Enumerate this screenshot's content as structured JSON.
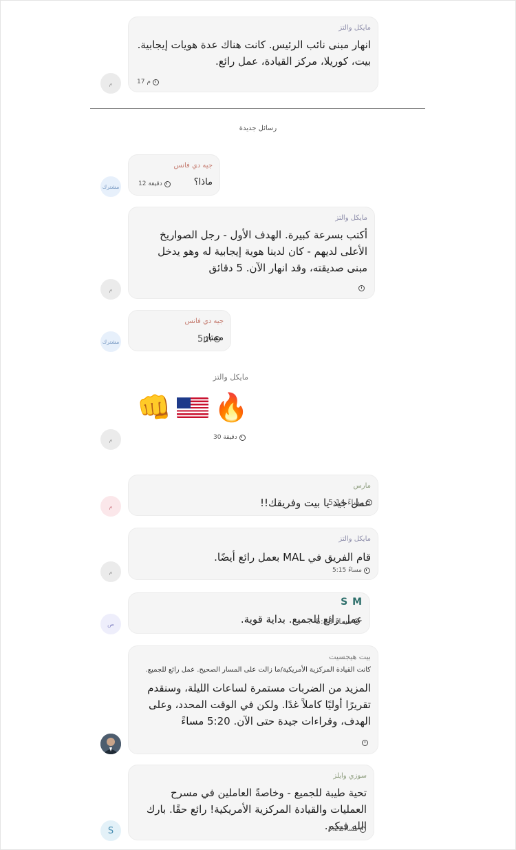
{
  "messages": [
    {
      "sender": "مايكل والتز",
      "text": "انهار مبنى نائب الرئيس. كانت هناك عدة هويات إيجابية. بيت، كوريلا، مركز القيادة، عمل رائع.",
      "time": "17 م",
      "avatar": "م"
    },
    {
      "sender": "جيه دي فانس",
      "text": "ماذا؟",
      "time": "12 دقيقة",
      "avatar": "مشترك"
    },
    {
      "sender": "مايكل والتز",
      "text": "أكتب بسرعة كبيرة. الهدف الأول - رجل الصواريخ الأعلى لديهم - كان لدينا هوية إيجابية له وهو يدخل مبنى صديقته، وقد انهار الآن. 5 دقائق",
      "time": "",
      "avatar": "م"
    },
    {
      "sender": "جيه دي فانس",
      "text": "ممتاز",
      "time": "5m",
      "avatar": "مشترك"
    },
    {
      "sender": "مايكل والتز",
      "emojis": [
        "👊",
        "🇺🇸",
        "🔥"
      ],
      "time": "30 دقيقة",
      "avatar": "م"
    },
    {
      "sender": "مارس",
      "text": "عمل جيد يا بيت وفريقك!!",
      "time": "5:14 مساءً",
      "avatar": "م"
    },
    {
      "sender": "مايكل والتز",
      "text_before": "قام الفريق في ",
      "text_mal": "MAL",
      "text_after": " بعمل رائع أيضًا.",
      "time": "5:15 مساءً",
      "avatar": "م"
    },
    {
      "sender": "S M",
      "text": "عمل رائع للجميع. بداية قوية.",
      "time": "5:18 مساءً",
      "avatar": "ص"
    },
    {
      "sender": "بيت هيجسيت",
      "subtitle": "كانت القيادة المركزية الأمريكية/ما زالت على المسار الصحيح. عمل رائع للجميع.",
      "text": "المزيد من الضربات مستمرة لساعات الليلة، وسنقدم تقريرًا أوليًا كاملاً غدًا. ولكن في الوقت المحدد، وعلى الهدف، وقراءات جيدة حتى الآن. 5:20 مساءً",
      "time": ""
    },
    {
      "sender": "سوزي وايلز",
      "text": "تحية طيبة للجميع - وخاصةً العاملين في مسرح العمليات والقيادة المركزية الأمريكية! رائع حقًا. بارك الله فيكم.",
      "time": "5:21 مساءً",
      "avatar": "S"
    }
  ],
  "divider_label": "رسائل جديدة"
}
